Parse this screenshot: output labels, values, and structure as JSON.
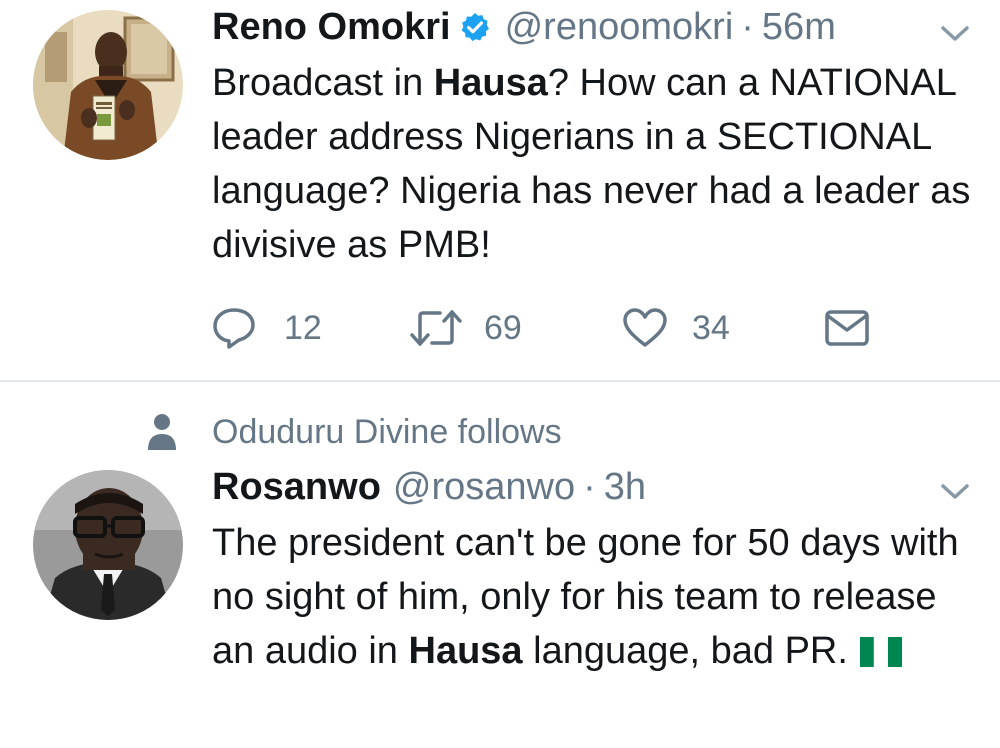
{
  "tweets": [
    {
      "author_name": "Reno Omokri",
      "verified": true,
      "handle": "@renoomokri",
      "separator": "·",
      "time": "56m",
      "text_segments": [
        "Broadcast in ",
        "Hausa",
        "? How can a NATIONAL leader address Nigerians in a SECTIONAL language? Nigeria has never had a leader as divisive as PMB!"
      ],
      "actions": {
        "replies": "12",
        "retweets": "69",
        "likes": "34"
      }
    },
    {
      "social_context": "Oduduru Divine follows",
      "author_name": "Rosanwo",
      "handle": "@rosanwo",
      "separator": "·",
      "time": "3h",
      "text_segments": [
        "The president can't be gone for 50 days with no sight of him, only for his team to release an audio in ",
        "Hausa",
        " language, bad PR."
      ],
      "emoji": "nigeria-flag"
    }
  ],
  "colors": {
    "text_primary": "#14171a",
    "text_secondary": "#657786",
    "verified_blue": "#1da1f2",
    "divider": "#e1e8ed",
    "flag_green": "#008751"
  },
  "icons": {
    "verified": "verified-badge-icon",
    "chevron": "chevron-down-icon",
    "reply": "reply-icon",
    "retweet": "retweet-icon",
    "like": "heart-icon",
    "dm": "envelope-icon",
    "social": "person-icon"
  }
}
